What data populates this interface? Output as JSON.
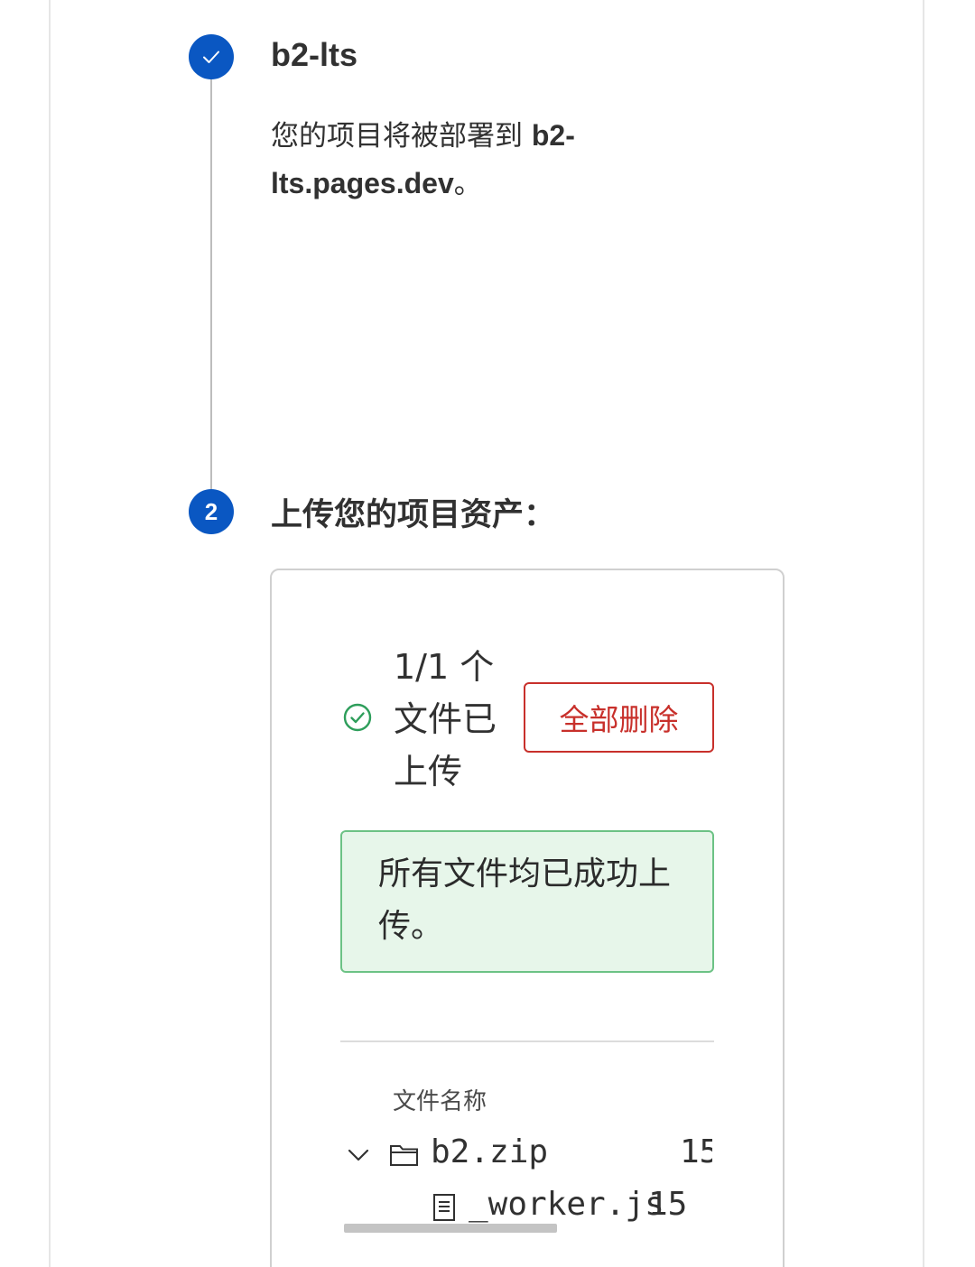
{
  "step1": {
    "title": "b2-lts",
    "description_prefix": "您的项目将被部署到 ",
    "domain": "b2-lts.pages.dev",
    "description_suffix": "。"
  },
  "step2": {
    "number": "2",
    "title": "上传您的项目资产："
  },
  "upload": {
    "status_text": "1/1 个文件已上传",
    "delete_all_label": "全部删除",
    "success_message": "所有文件均已成功上传。",
    "column_header": "文件名称",
    "files": [
      {
        "name": "b2.zip",
        "size": "15",
        "type": "folder"
      },
      {
        "name": "_worker.js",
        "size": "15",
        "type": "file"
      }
    ]
  },
  "colors": {
    "accent": "#0a57c2",
    "danger": "#c8302b",
    "success_bg": "#e7f6ea",
    "success_border": "#6cc285",
    "success_icon": "#2e9e5b"
  },
  "icons": [
    "check-icon",
    "check-circle-icon",
    "chevron-down-icon",
    "folder-icon",
    "file-icon"
  ]
}
